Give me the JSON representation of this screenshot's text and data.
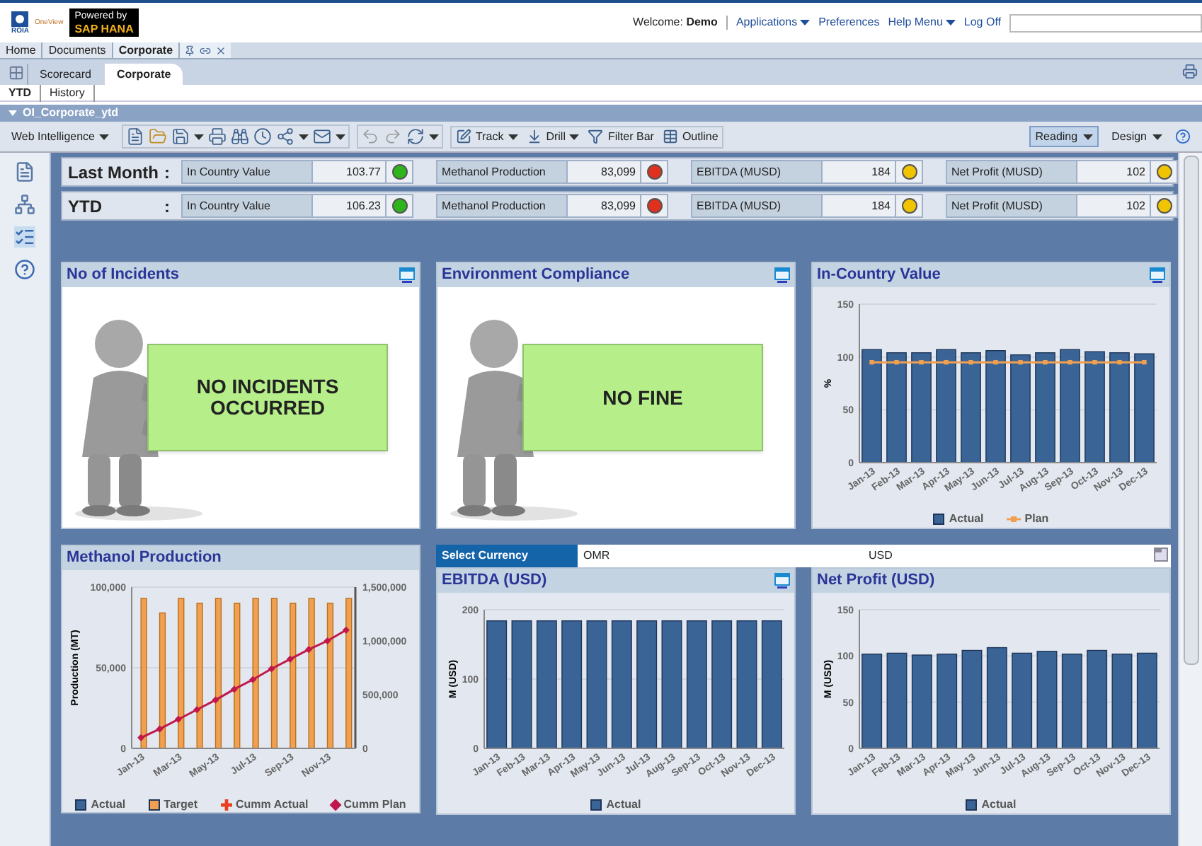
{
  "header": {
    "logo_name": "ROIA",
    "logo_product": "OneView",
    "badge_line1": "Powered by",
    "badge_line2": "SAP HANA",
    "welcome_label": "Welcome:",
    "user": "Demo",
    "links": [
      {
        "label": "Applications",
        "dropdown": true
      },
      {
        "label": "Preferences",
        "dropdown": false
      },
      {
        "label": "Help Menu",
        "dropdown": true
      },
      {
        "label": "Log Off",
        "dropdown": false
      }
    ]
  },
  "app_tabs": [
    {
      "label": "Home",
      "selected": false
    },
    {
      "label": "Documents",
      "selected": false
    },
    {
      "label": "Corporate",
      "selected": true
    }
  ],
  "doc_tabs": [
    {
      "label": "Scorecard",
      "selected": false
    },
    {
      "label": "Corporate",
      "selected": true
    }
  ],
  "report_tabs": [
    {
      "label": "YTD",
      "selected": true
    },
    {
      "label": "History",
      "selected": false
    }
  ],
  "document_title": "OI_Corporate_ytd",
  "toolbar": {
    "menu": "Web Intelligence",
    "actions": [
      {
        "label": "Track",
        "dropdown": true
      },
      {
        "label": "Drill",
        "dropdown": true
      },
      {
        "label": "Filter Bar",
        "dropdown": false
      },
      {
        "label": "Outline",
        "dropdown": false
      }
    ],
    "modes": [
      {
        "label": "Reading",
        "selected": true
      },
      {
        "label": "Design",
        "selected": false
      }
    ]
  },
  "kpi_rows": [
    {
      "label": "Last Month",
      "separator": ":",
      "items": [
        {
          "name": "In Country Value",
          "value": "103.77",
          "color": "#2fb41e"
        },
        {
          "name": "Methanol Production",
          "value": "83,099",
          "color": "#e0301e"
        },
        {
          "name": "EBITDA (MUSD)",
          "value": "184",
          "color": "#f0c400"
        },
        {
          "name": "Net Profit (MUSD)",
          "value": "102",
          "color": "#f0c400"
        }
      ]
    },
    {
      "label": "YTD",
      "separator": ":",
      "items": [
        {
          "name": "In Country Value",
          "value": "106.23",
          "color": "#2fb41e"
        },
        {
          "name": "Methanol Production",
          "value": "83,099",
          "color": "#e0301e"
        },
        {
          "name": "EBITDA (MUSD)",
          "value": "184",
          "color": "#f0c400"
        },
        {
          "name": "Net Profit (MUSD)",
          "value": "102",
          "color": "#f0c400"
        }
      ]
    }
  ],
  "panels": [
    {
      "kind": "picture",
      "title": "No of Incidents",
      "menu_icon": true,
      "sign_text": "NO INCIDENTS OCCURRED"
    },
    {
      "kind": "picture",
      "title": "Environment Compliance",
      "menu_icon": true,
      "sign_text": "NO FINE"
    },
    {
      "kind": "chart",
      "title": "In-Country Value",
      "menu_icon": true,
      "chart_data": {
        "type": "bar",
        "legend": "bottom",
        "stacked": false,
        "ylabel": "%",
        "categories": [
          "Jan-13",
          "Feb-13",
          "Mar-13",
          "Apr-13",
          "May-13",
          "Jun-13",
          "Jul-13",
          "Aug-13",
          "Sep-13",
          "Oct-13",
          "Nov-13",
          "Dec-13"
        ],
        "ylim": [
          0,
          150
        ],
        "yticks": [
          0,
          50,
          100,
          150
        ],
        "series": [
          {
            "name": "Actual",
            "color": "#3a6496",
            "values": [
              107,
              104,
              104,
              107,
              104,
              106,
              102,
              104,
              107,
              105,
              104,
              103
            ]
          },
          {
            "name": "Plan",
            "type": "line",
            "marker": "square",
            "color": "#f0a050",
            "values": [
              95,
              95,
              95,
              95,
              95,
              95,
              95,
              95,
              95,
              95,
              95,
              95
            ]
          }
        ]
      }
    },
    {
      "kind": "chart",
      "title": "Methanol Production",
      "menu_icon": false,
      "chart_data": {
        "type": "bar",
        "legend": "bottom",
        "stacked": false,
        "ylabel": "Production (MT)",
        "categories": [
          "Jan-13",
          null,
          "Mar-13",
          null,
          "May-13",
          null,
          "Jul-13",
          null,
          "Sep-13",
          null,
          "Nov-13",
          null
        ],
        "ylim": [
          0,
          100000
        ],
        "yticks": [
          0,
          {
            "value": 50000,
            "label": "50,000"
          },
          {
            "value": 100000,
            "label": "100,000"
          }
        ],
        "y2lim": [
          0,
          1500000
        ],
        "y2ticks": [
          0,
          {
            "value": 500000,
            "label": "500,000"
          },
          {
            "value": 1000000,
            "label": "1,000,000"
          },
          {
            "value": 1500000,
            "label": "1,500,000"
          }
        ],
        "series": [
          {
            "name": "Actual",
            "color": "#3a6496",
            "values": [
              null,
              null,
              null,
              null,
              null,
              null,
              null,
              null,
              null,
              null,
              null,
              null
            ]
          },
          {
            "name": "Target",
            "color": "#f0a050",
            "values": [
              93000,
              84000,
              93000,
              90000,
              93000,
              90000,
              93000,
              93000,
              90000,
              93000,
              90000,
              93000
            ]
          },
          {
            "name": "Cumm Actual",
            "type": "line",
            "marker": "cross",
            "color": "#e84020",
            "values": [
              null,
              null,
              null,
              null,
              null,
              null,
              null,
              null,
              null,
              null,
              null,
              null
            ]
          },
          {
            "name": "Cumm Plan",
            "type": "line",
            "marker": "diamond",
            "axis": "y2",
            "color": "#c0184a",
            "values": [
              100000,
              180000,
              270000,
              360000,
              450000,
              550000,
              640000,
              740000,
              830000,
              920000,
              1000000,
              1100000
            ]
          }
        ]
      }
    },
    {
      "kind": "chart",
      "title": "EBITDA (USD)",
      "menu_icon": true,
      "chart_data": {
        "type": "bar",
        "legend": "bottom",
        "stacked": false,
        "ylabel": "M (USD)",
        "categories": [
          "Jan-13",
          "Feb-13",
          "Mar-13",
          "Apr-13",
          "May-13",
          "Jun-13",
          "Jul-13",
          "Aug-13",
          "Sep-13",
          "Oct-13",
          "Nov-13",
          "Dec-13"
        ],
        "ylim": [
          0,
          200
        ],
        "yticks": [
          0,
          100,
          200
        ],
        "series": [
          {
            "name": "Actual",
            "color": "#3a6496",
            "values": [
              184,
              184,
              184,
              184,
              184,
              184,
              184,
              184,
              184,
              184,
              184,
              184
            ]
          }
        ]
      }
    },
    {
      "kind": "chart",
      "title": "Net Profit (USD)",
      "menu_icon": false,
      "chart_data": {
        "type": "bar",
        "legend": "bottom",
        "stacked": false,
        "ylabel": "M (USD)",
        "categories": [
          "Jan-13",
          "Feb-13",
          "Mar-13",
          "Apr-13",
          "May-13",
          "Jun-13",
          "Jul-13",
          "Aug-13",
          "Sep-13",
          "Oct-13",
          "Nov-13",
          "Dec-13"
        ],
        "ylim": [
          0,
          150
        ],
        "yticks": [
          0,
          50,
          100,
          150
        ],
        "series": [
          {
            "name": "Actual",
            "color": "#3a6496",
            "values": [
              102,
              103,
              101,
              102,
              106,
              109,
              103,
              105,
              102,
              106,
              102,
              103
            ]
          }
        ]
      }
    }
  ],
  "currency": {
    "label": "Select Currency",
    "options": [
      "OMR",
      "USD"
    ]
  }
}
